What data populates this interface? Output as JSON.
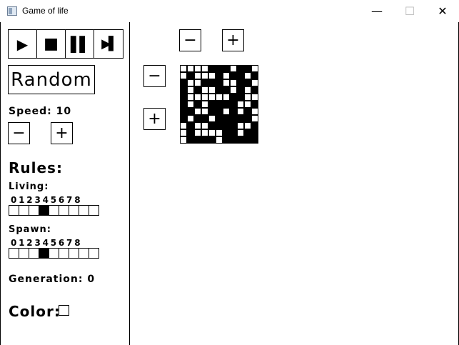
{
  "window": {
    "title": "Game of life",
    "minimize": "—",
    "maximize": "☐",
    "close": "✕"
  },
  "controls": {
    "play": "▶",
    "stop": "■",
    "pause": "▌▌",
    "step": "▶▌"
  },
  "random_label": "Random",
  "speed": {
    "label": "Speed: 10",
    "minus": "−",
    "plus": "+"
  },
  "rules": {
    "title": "Rules:",
    "living": {
      "label": "Living:",
      "digits": "012345678",
      "active": [
        3
      ]
    },
    "spawn": {
      "label": "Spawn:",
      "digits": "012345678",
      "active": [
        3
      ]
    }
  },
  "generation_label": "Generation: 0",
  "color_label": "Color:",
  "grid_controls": {
    "col_minus": "−",
    "col_plus": "+",
    "row_minus": "−",
    "row_plus": "+"
  },
  "grid": [
    "00001110110",
    "01000101101",
    "10011100110",
    "10100110101",
    "10000001100",
    "10101111001",
    "11001101010",
    "10110111110",
    "01001111001",
    "01000011011",
    "01111011111"
  ]
}
